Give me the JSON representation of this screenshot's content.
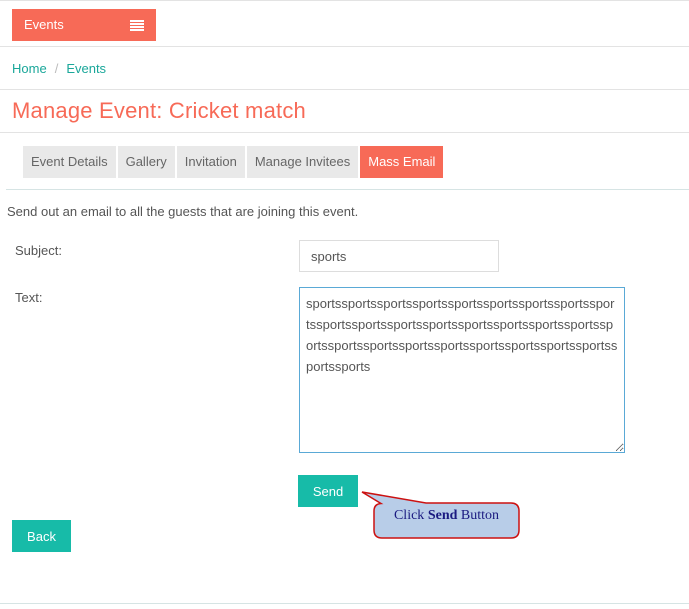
{
  "topbar": {
    "events_label": "Events"
  },
  "breadcrumb": {
    "home": "Home",
    "separator": "/",
    "current": "Events"
  },
  "page": {
    "title": "Manage Event: Cricket match"
  },
  "tabs": [
    {
      "label": "Event Details",
      "active": false
    },
    {
      "label": "Gallery",
      "active": false
    },
    {
      "label": "Invitation",
      "active": false
    },
    {
      "label": "Manage Invitees",
      "active": false
    },
    {
      "label": "Mass Email",
      "active": true
    }
  ],
  "form": {
    "intro": "Send out an email to all the guests that are joining this event.",
    "subject_label": "Subject:",
    "subject_value": "sports",
    "text_label": "Text:",
    "text_value": "sportssportssportssportssportssportssportssportssportssportssportssportssportssportssportssportssportssportssportssportssportssportssportssportssportssportssportssports",
    "send_label": "Send",
    "back_label": "Back"
  },
  "callout": {
    "prefix": "Click ",
    "bold": "Send",
    "suffix": " Button"
  },
  "colors": {
    "accent": "#f76a57",
    "primary_button": "#17bba8",
    "link": "#1aa79a",
    "callout_fill": "#b8cde8",
    "callout_border": "#cc1111"
  }
}
